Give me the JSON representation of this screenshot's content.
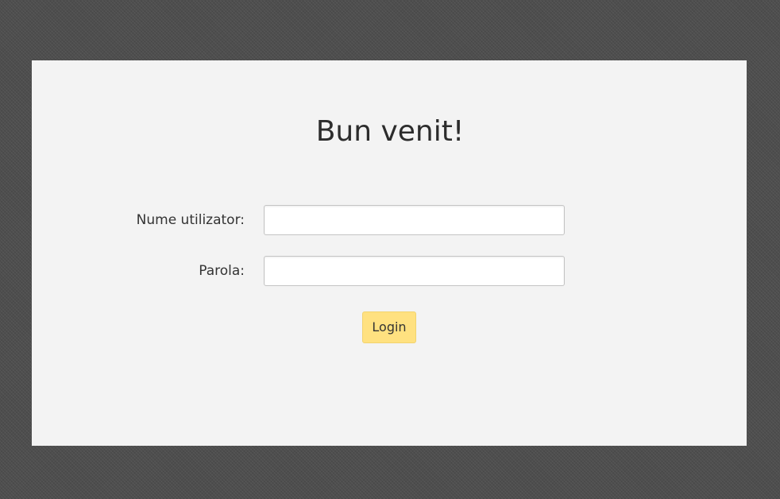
{
  "page": {
    "title": "Bun venit!"
  },
  "form": {
    "username_label": "Nume utilizator:",
    "username_value": "",
    "password_label": "Parola:",
    "password_value": "",
    "login_label": "Login"
  },
  "colors": {
    "page_background": "#4e4e4e",
    "panel_background": "#f3f3f3",
    "button_background": "#ffe180",
    "text": "#333333"
  }
}
